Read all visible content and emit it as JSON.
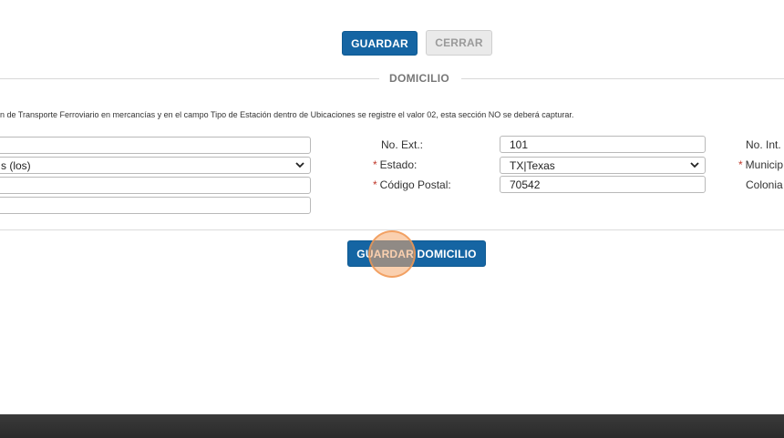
{
  "toolbar": {
    "save_label": "GUARDAR",
    "close_label": "CERRAR"
  },
  "section": {
    "title": "DOMICILIO",
    "note": "n de Transporte Ferroviario en mercancías y en el campo Tipo de Estación dentro de Ubicaciones se registre el valor 02, esta sección NO se deberá capturar."
  },
  "form": {
    "left_col": {
      "field1_value": "",
      "pais_value": "s (los)",
      "field3_value": "",
      "field4_value": ""
    },
    "no_ext": {
      "label": "No. Ext.:",
      "value": "101"
    },
    "estado": {
      "required_mark": "*",
      "label": "Estado:",
      "value": "TX|Texas"
    },
    "codigo_postal": {
      "required_mark": "*",
      "label": "Código Postal:",
      "value": "70542"
    },
    "no_int": {
      "label": "No. Int."
    },
    "municipio": {
      "required_mark": "*",
      "label": "Municip"
    },
    "colonia": {
      "label": "Colonia"
    }
  },
  "actions": {
    "save_address_label": "GUARDAR DOMICILIO"
  },
  "colors": {
    "primary": "#1565a3",
    "required": "#c0392b",
    "cursor_highlight": "#f6aa6e"
  }
}
